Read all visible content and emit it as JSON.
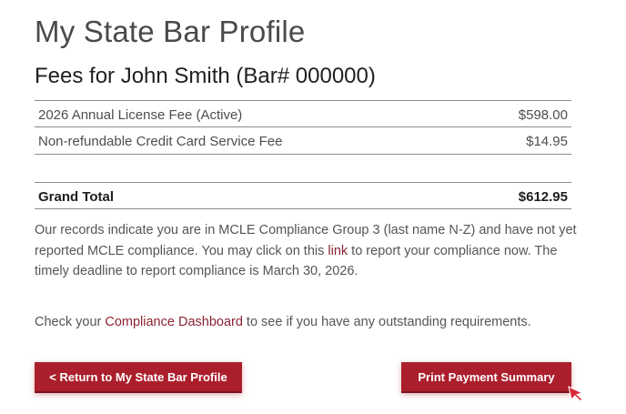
{
  "page": {
    "title": "My State Bar Profile",
    "fees_heading": "Fees for John Smith (Bar# 000000)"
  },
  "fees": {
    "items": [
      {
        "label": "2026 Annual License Fee (Active)",
        "amount": "$598.00"
      },
      {
        "label": "Non-refundable Credit Card Service Fee",
        "amount": "$14.95"
      }
    ],
    "total": {
      "label": "Grand Total",
      "amount": "$612.95"
    }
  },
  "mcle_notice": {
    "before_link": "Our records indicate you are in MCLE Compliance Group 3 (last name N-Z) and have not yet reported MCLE compliance. You may click on this ",
    "link_text": "link",
    "after_link": " to report your compliance now. The timely deadline to report compliance is March 30, 2026."
  },
  "dashboard_notice": {
    "before_link": "Check your ",
    "link_text": "Compliance Dashboard",
    "after_link": " to see if you have any outstanding requirements."
  },
  "buttons": {
    "return_label": "< Return to My State Bar Profile",
    "print_label": "Print Payment Summary"
  },
  "colors": {
    "accent": "#ab1f2c",
    "link": "#8b2332"
  },
  "icons": {
    "cursor": "mouse-pointer-icon"
  }
}
